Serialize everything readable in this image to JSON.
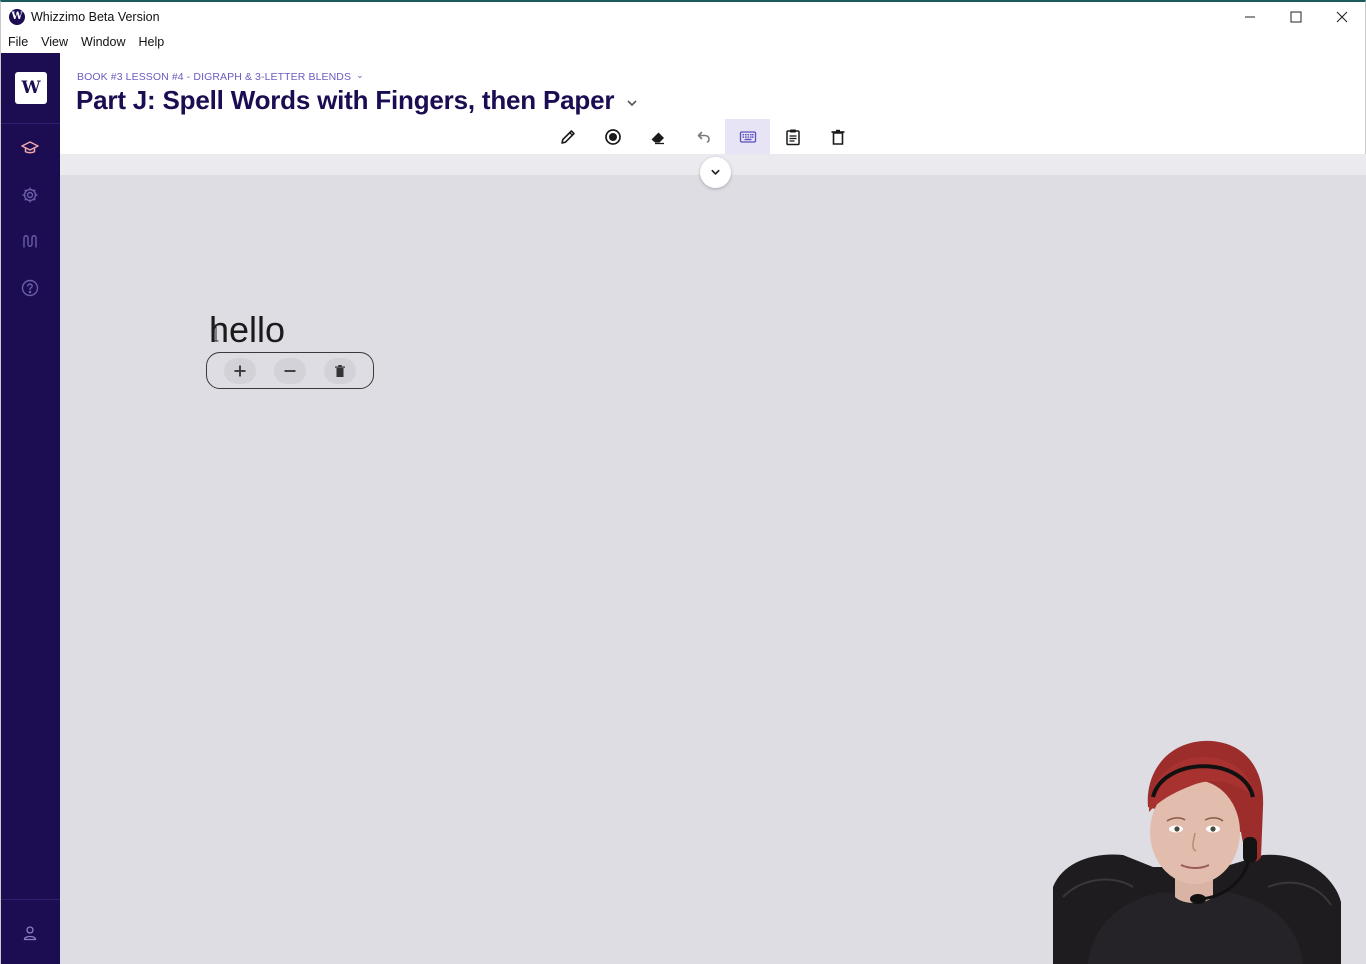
{
  "window": {
    "app_logo": "W",
    "title": "Whizzimo Beta Version",
    "controls": [
      "minimize-icon",
      "maximize-icon",
      "close-icon"
    ]
  },
  "menu": [
    "File",
    "View",
    "Window",
    "Help"
  ],
  "sidebar": {
    "logo": "W",
    "items": [
      {
        "name": "graduation-cap-icon"
      },
      {
        "name": "gear-icon"
      },
      {
        "name": "route-icon"
      },
      {
        "name": "help-circle-icon"
      }
    ],
    "bottom": {
      "name": "user-icon"
    }
  },
  "header": {
    "breadcrumb": "BOOK #3 LESSON #4 - DIGRAPH & 3-LETTER BLENDS",
    "title": "Part J: Spell Words with Fingers, then Paper"
  },
  "toolbar": {
    "tools": [
      {
        "name": "pencil-icon",
        "active": false
      },
      {
        "name": "record-icon",
        "active": false
      },
      {
        "name": "eraser-icon",
        "active": false
      },
      {
        "name": "undo-icon",
        "active": false
      },
      {
        "name": "keyboard-icon",
        "active": true
      },
      {
        "name": "clipboard-icon",
        "active": false
      },
      {
        "name": "trash-icon",
        "active": false
      }
    ]
  },
  "canvas": {
    "word": "hello",
    "word_controls": [
      "plus-icon",
      "minus-icon",
      "trash-icon"
    ]
  },
  "colors": {
    "sidebar": "#1c0c52",
    "title": "#1c0c52",
    "breadcrumb": "#6b5cc2",
    "canvas": "#dddde3",
    "active_tool": "#e6e4f5"
  }
}
